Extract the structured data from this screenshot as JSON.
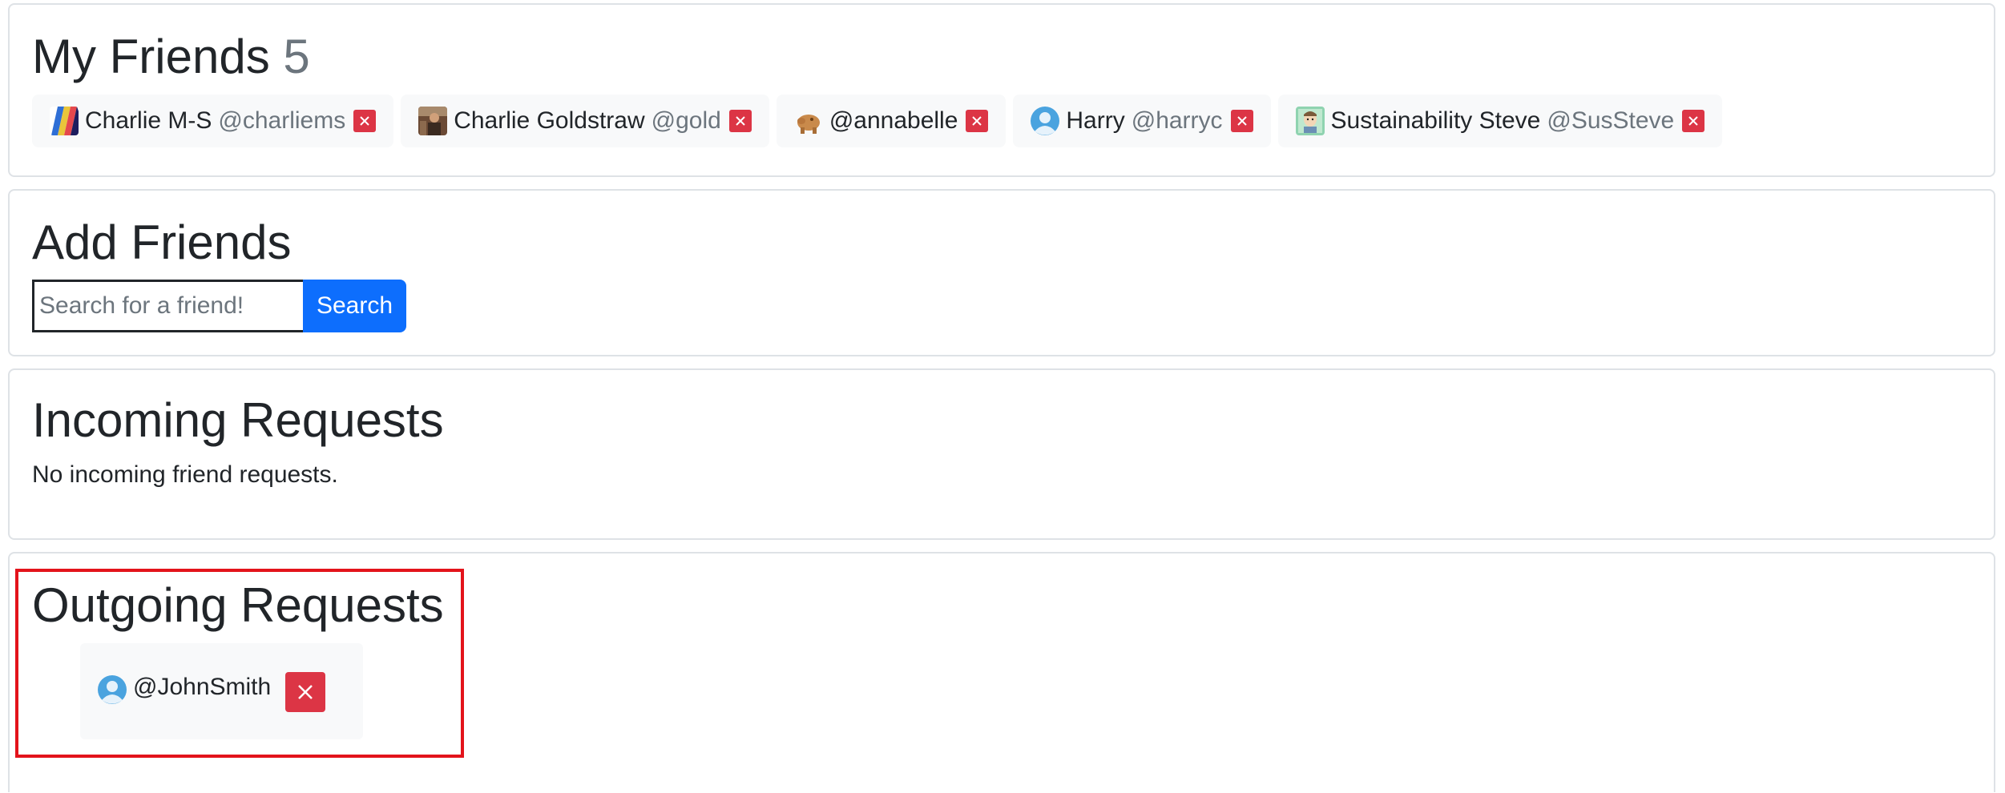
{
  "my_friends": {
    "title": "My Friends",
    "count": "5",
    "friends": [
      {
        "name": "Charlie M-S",
        "handle": "@charliems",
        "avatar_icon": "rainbow-stripes-avatar"
      },
      {
        "name": "Charlie Goldstraw",
        "handle": "@gold",
        "avatar_icon": "photo-avatar"
      },
      {
        "name": "",
        "handle": "@annabelle",
        "avatar_icon": "pig-emoji-avatar"
      },
      {
        "name": "Harry",
        "handle": "@harryc",
        "avatar_icon": "default-user-avatar"
      },
      {
        "name": "Sustainability Steve",
        "handle": "@SusSteve",
        "avatar_icon": "cartoon-face-avatar"
      }
    ]
  },
  "add_friends": {
    "title": "Add Friends",
    "search_placeholder": "Search for a friend!",
    "search_value": "",
    "search_button_label": "Search"
  },
  "incoming": {
    "title": "Incoming Requests",
    "empty_text": "No incoming friend requests."
  },
  "outgoing": {
    "title": "Outgoing Requests",
    "requests": [
      {
        "handle": "@JohnSmith",
        "avatar_icon": "default-user-avatar"
      }
    ]
  },
  "colors": {
    "primary": "#0d6efd",
    "danger": "#dc3545",
    "muted": "#6c757d",
    "chip_bg": "#f8f9fa",
    "highlight": "#e3131b"
  }
}
